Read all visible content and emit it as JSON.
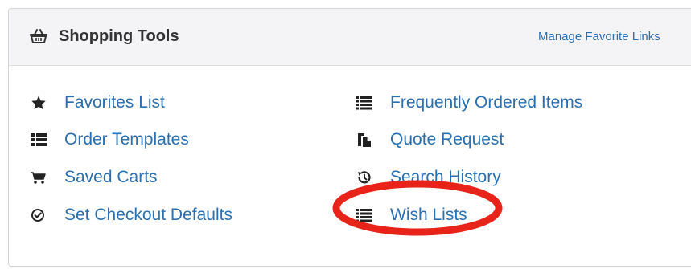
{
  "header": {
    "title": "Shopping Tools",
    "icon": "shopping-basket-icon",
    "manage_link": "Manage Favorite Links"
  },
  "tools_left": [
    {
      "label": "Favorites List",
      "icon": "star-icon"
    },
    {
      "label": "Order Templates",
      "icon": "list-bullets-icon"
    },
    {
      "label": "Saved Carts",
      "icon": "cart-icon"
    },
    {
      "label": "Set Checkout Defaults",
      "icon": "check-circle-icon"
    }
  ],
  "tools_right": [
    {
      "label": "Frequently Ordered Items",
      "icon": "list-icon"
    },
    {
      "label": "Quote Request",
      "icon": "clipboard-copy-icon"
    },
    {
      "label": "Search History",
      "icon": "history-icon"
    },
    {
      "label": "Wish Lists",
      "icon": "list-icon"
    }
  ],
  "colors": {
    "link": "#2a6fb0",
    "title": "#333333",
    "header_bg": "#f4f4f7",
    "highlight": "#e8231a"
  }
}
